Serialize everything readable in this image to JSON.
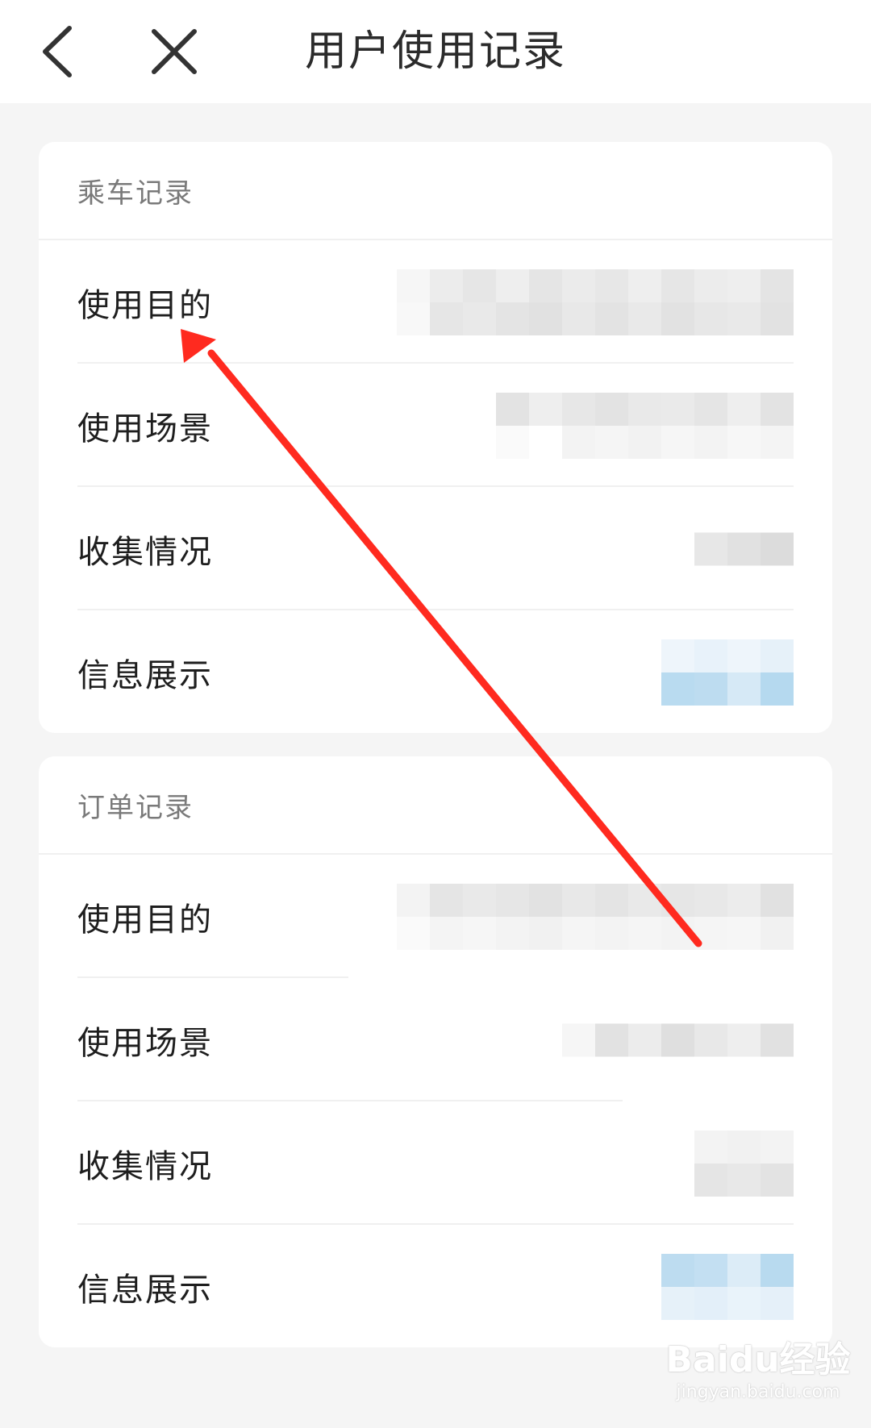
{
  "header": {
    "title": "用户使用记录"
  },
  "icons": {
    "back": "chevron-left-icon",
    "close": "close-icon"
  },
  "sections": [
    {
      "title": "乘车记录",
      "rows": [
        {
          "label": "使用目的",
          "value_display": "blurred"
        },
        {
          "label": "使用场景",
          "value_display": "blurred"
        },
        {
          "label": "收集情况",
          "value_display": "blurred"
        },
        {
          "label": "信息展示",
          "value_display": "blurred"
        }
      ]
    },
    {
      "title": "订单记录",
      "rows": [
        {
          "label": "使用目的",
          "value_display": "blurred"
        },
        {
          "label": "使用场景",
          "value_display": "blurred"
        },
        {
          "label": "收集情况",
          "value_display": "blurred"
        },
        {
          "label": "信息展示",
          "value_display": "blurred"
        }
      ]
    }
  ],
  "annotation": {
    "arrow_color": "#ff2a1f"
  },
  "watermark": {
    "logo": "Baidu经验",
    "url": "jingyan.baidu.com"
  },
  "colors": {
    "background": "#f5f5f5",
    "card": "#ffffff",
    "blur_gray": "#e3e3e3",
    "blur_blue": "#b9dbf0"
  }
}
